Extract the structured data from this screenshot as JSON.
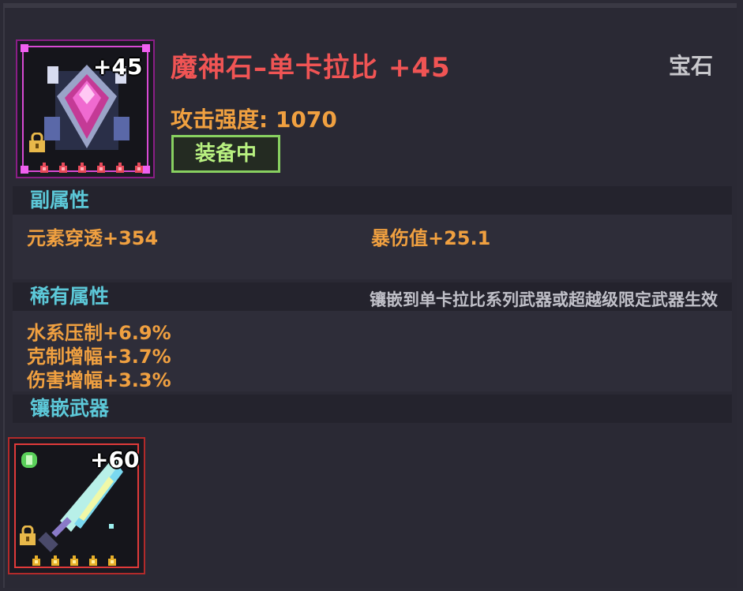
{
  "item": {
    "level": "+45",
    "name": "魔神石–单卡拉比 +45",
    "category": "宝石",
    "attack": "攻击强度: 1070",
    "equipped": "装备中",
    "star_count": 6,
    "locked": true
  },
  "secondary": {
    "header": "副属性",
    "stats": [
      "元素穿透+354",
      "暴伤值+25.1"
    ]
  },
  "rare": {
    "header": "稀有属性",
    "note": "镶嵌到单卡拉比系列武器或超越级限定武器生效",
    "stats": [
      "水系压制+6.9%",
      "克制增幅+3.7%",
      "伤害增幅+3.3%"
    ]
  },
  "inlay": {
    "header": "镶嵌武器",
    "weapon_level": "+60",
    "star_count": 5,
    "locked": true
  },
  "colors": {
    "title": "#f05454",
    "stat": "#f0a040",
    "header": "#5cc8d8",
    "equipped": "#88d060",
    "gem_frame": "#d84ad4",
    "weapon_frame": "#e03a3a"
  }
}
